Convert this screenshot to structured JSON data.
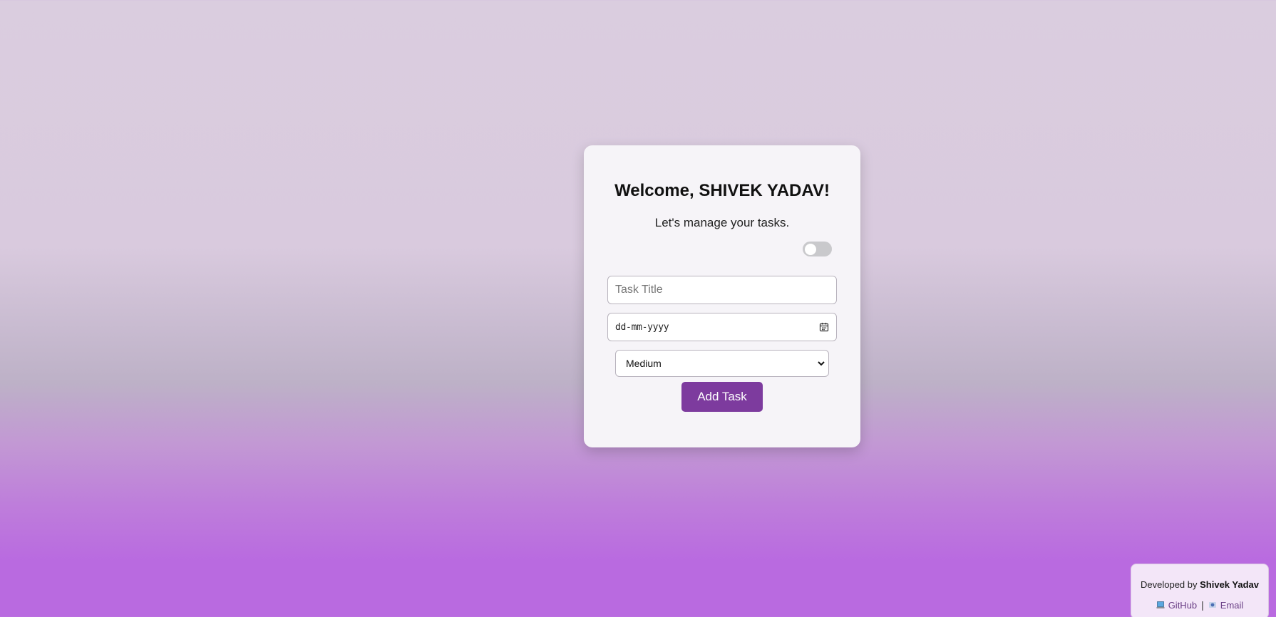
{
  "card": {
    "heading": "Welcome, SHIVEK YADAV!",
    "subheading": "Let's manage your tasks.",
    "theme_toggle": {
      "state": "off"
    },
    "task_title": {
      "placeholder": "Task Title",
      "value": ""
    },
    "due_date": {
      "placeholder": "dd-mm-yyyy",
      "icon": "calendar-icon"
    },
    "priority": {
      "selected": "Medium"
    },
    "add_button": "Add Task"
  },
  "footer": {
    "developed_by": "Developed by",
    "developer_name": "Shivek Yadav",
    "github_label": "GitHub",
    "github_icon": "laptop-icon",
    "separator": "|",
    "email_label": "Email",
    "email_icon": "email-icon"
  },
  "colors": {
    "accent": "#7d3b9e",
    "card_bg": "#f6f4f8",
    "link": "#6a3f86",
    "toggle_off": "#c9c9cc"
  }
}
